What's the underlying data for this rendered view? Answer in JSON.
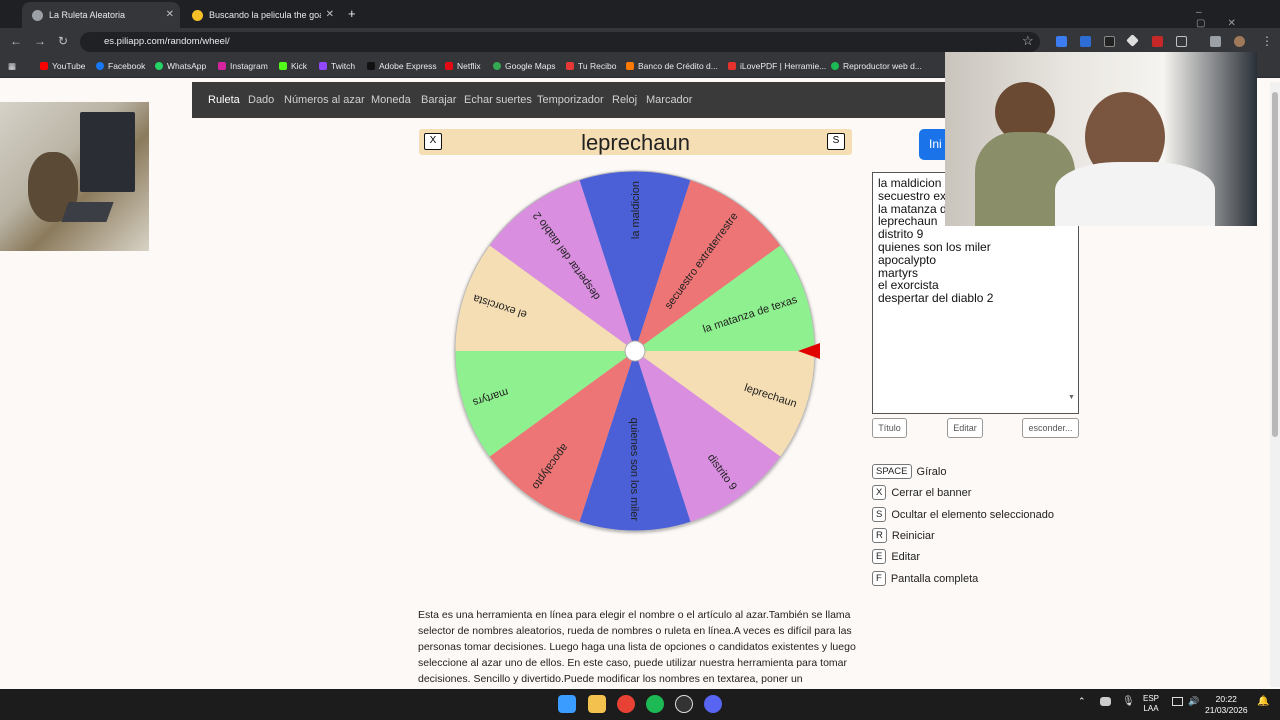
{
  "browser": {
    "tabs": [
      {
        "title": "La Ruleta Aleatoria",
        "active": true
      },
      {
        "title": "Buscando la pelicula the goat",
        "active": false
      }
    ],
    "new_tab": "+",
    "url": "es.piliapp.com/random/wheel/",
    "bookmarks": [
      "YouTube",
      "Facebook",
      "WhatsApp",
      "Instagram",
      "Kick",
      "Twitch",
      "Adobe Express",
      "Netflix",
      "Google Maps",
      "Tu Recibo",
      "Banco de Crédito d...",
      "iLovePDF | Herramie...",
      "Reproductor web d..."
    ]
  },
  "site_nav": [
    "Ruleta",
    "Dado",
    "Números al azar",
    "Moneda",
    "Barajar",
    "Echar suertes",
    "Temporizador",
    "Reloj",
    "Marcador"
  ],
  "banner": {
    "close_key": "X",
    "hide_key": "S",
    "selected": "leprechaun"
  },
  "start_button": "Ini",
  "wheel": {
    "segments": [
      {
        "label": "la maldicion",
        "color": "#4b5fd6"
      },
      {
        "label": "secuestro extraterrestre",
        "color": "#ee7474"
      },
      {
        "label": "la matanza de texas",
        "color": "#8ef08e"
      },
      {
        "label": "leprechaun",
        "color": "#f5deb3"
      },
      {
        "label": "distrito 9",
        "color": "#d98ee0"
      },
      {
        "label": "quienes son los miler",
        "color": "#4b5fd6"
      },
      {
        "label": "apocalypto",
        "color": "#ee7474"
      },
      {
        "label": "martyrs",
        "color": "#8ef08e"
      },
      {
        "label": "el exorcista",
        "color": "#f5deb3"
      },
      {
        "label": "despertar del diablo 2",
        "color": "#d98ee0"
      }
    ],
    "pointer_color": "#e00000"
  },
  "textarea_lines": [
    "la maldicion",
    "secuestro ex",
    "la matanza d",
    "leprechaun",
    "distrito 9",
    "quienes son los miler",
    "apocalypto",
    "martyrs",
    "el exorcista",
    "despertar del diablo 2"
  ],
  "buttons": {
    "title": "Título",
    "edit": "Editar",
    "hide": "esconder..."
  },
  "shortcuts": [
    {
      "key": "SPACE",
      "label": "Gíralo"
    },
    {
      "key": "X",
      "label": "Cerrar el banner"
    },
    {
      "key": "S",
      "label": "Ocultar el elemento seleccionado"
    },
    {
      "key": "R",
      "label": "Reiniciar"
    },
    {
      "key": "E",
      "label": "Editar"
    },
    {
      "key": "F",
      "label": "Pantalla completa"
    }
  ],
  "description": "Esta es una herramienta en línea para elegir el nombre o el artículo al azar.También se llama selector de nombres aleatorios, rueda de nombres o ruleta en línea.A veces es difícil para las personas tomar decisiones. Luego haga una lista de opciones o candidatos existentes y luego seleccione al azar uno de ellos. En este caso, puede utilizar nuestra herramienta para tomar decisiones. Sencillo y divertido.Puede modificar los nombres en textarea, poner un",
  "taskbar": {
    "lang": "ESP",
    "lang2": "LAA",
    "time": "20:22",
    "date": "21/03/2026"
  }
}
